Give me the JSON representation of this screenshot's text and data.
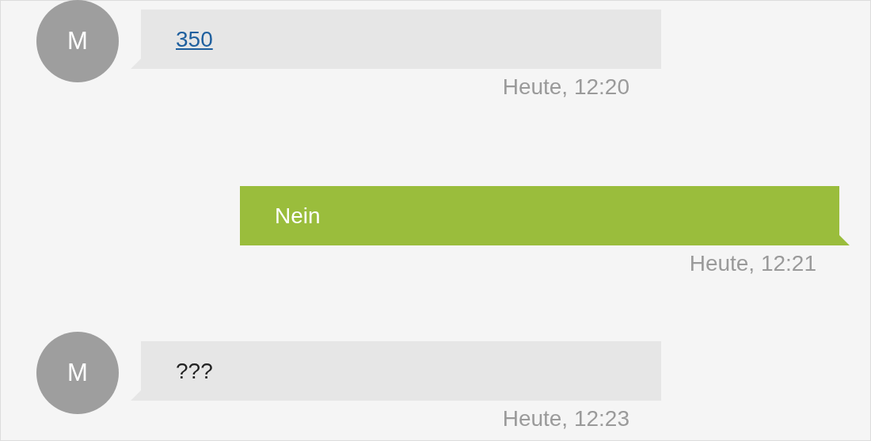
{
  "messages": [
    {
      "kind": "incoming",
      "avatar": "M",
      "text": "350",
      "link": true,
      "time": "Heute, 12:20"
    },
    {
      "kind": "outgoing",
      "text": "Nein",
      "link": false,
      "time": "Heute, 12:21"
    },
    {
      "kind": "incoming",
      "avatar": "M",
      "text": "???",
      "link": false,
      "time": "Heute, 12:23"
    }
  ]
}
